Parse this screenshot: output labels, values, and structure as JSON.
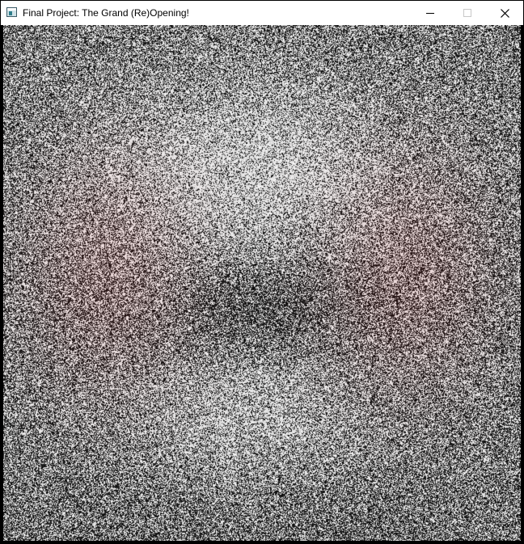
{
  "window": {
    "title": "Final Project: The Grand (Re)Opening!",
    "icon": "application-window-icon",
    "controls": {
      "minimize": "minimize-icon",
      "maximize": "maximize-icon",
      "close": "close-icon"
    }
  },
  "render": {
    "content": "noisy-render-canvas",
    "tint_color": "#e8cfcf",
    "base_color": "#5a5657"
  }
}
